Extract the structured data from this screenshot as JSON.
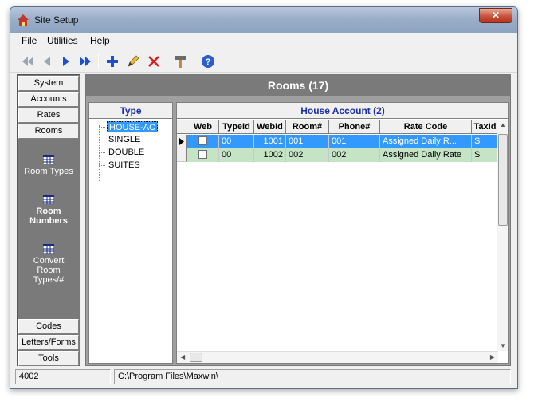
{
  "window": {
    "title": "Site Setup",
    "close_label": "✕"
  },
  "menu": [
    "File",
    "Utilities",
    "Help"
  ],
  "toolbar": {
    "buttons": [
      "first-icon",
      "prev-icon",
      "next-icon",
      "last-icon",
      "add-icon",
      "edit-icon",
      "delete-icon",
      "tools-icon",
      "help-icon"
    ]
  },
  "nav": {
    "top": [
      "System",
      "Accounts",
      "Rates",
      "Rooms"
    ],
    "sub": [
      "Room Types",
      "Room Numbers",
      "Convert Room Types/#"
    ],
    "bottom": [
      "Codes",
      "Letters/Forms",
      "Tools"
    ]
  },
  "content": {
    "header": "Rooms (17)",
    "type_header": "Type",
    "types": [
      "HOUSE-AC",
      "SINGLE",
      "DOUBLE",
      "SUITES"
    ],
    "grid_title": "House Account (2)",
    "columns": [
      "Web",
      "TypeId",
      "WebId",
      "Room#",
      "Phone#",
      "Rate Code",
      "TaxId"
    ],
    "rows": [
      {
        "typeid": "00",
        "webid": "1001",
        "room": "001",
        "phone": "001",
        "rate": "Assigned Daily R...",
        "tax": "S"
      },
      {
        "typeid": "00",
        "webid": "1002",
        "room": "002",
        "phone": "002",
        "rate": "Assigned Daily Rate",
        "tax": "S"
      }
    ]
  },
  "status": {
    "left": "4002",
    "right": "C:\\Program Files\\Maxwin\\"
  },
  "colors": {
    "selection": "#3399ff",
    "alt_row": "#c5e3c5",
    "header_text": "#1f2fa8",
    "panel_dark": "#7a7a7a"
  }
}
